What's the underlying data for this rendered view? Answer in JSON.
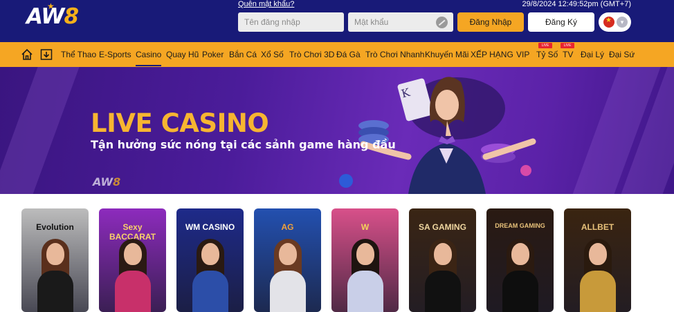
{
  "header": {
    "logo_text": "AW",
    "logo_eight": "8",
    "forgot_password": "Quên mật khẩu?",
    "datetime": "29/8/2024 12:49:52pm (GMT+7)",
    "username_placeholder": "Tên đăng nhập",
    "password_placeholder": "Mật khẩu",
    "login_label": "Đăng Nhập",
    "register_label": "Đăng Ký"
  },
  "nav": {
    "items": [
      {
        "label": "Thể Thao"
      },
      {
        "label": "E-Sports"
      },
      {
        "label": "Casino"
      },
      {
        "label": "Quay Hũ"
      },
      {
        "label": "Poker"
      },
      {
        "label": "Bắn Cá"
      },
      {
        "label": "Xổ Số"
      },
      {
        "label": "Trò Chơi 3D"
      },
      {
        "label": "Đá Gà"
      },
      {
        "label": "Trò Chơi Nhanh"
      },
      {
        "label": "Khuyến Mãi"
      },
      {
        "label": "XẾP HẠNG"
      },
      {
        "label": "VIP"
      },
      {
        "label": "Tỷ Số"
      },
      {
        "label": "TV"
      },
      {
        "label": "Đại Lý"
      },
      {
        "label": "Đại Sứ"
      }
    ],
    "active": "Casino",
    "live_badge": "LIVE"
  },
  "banner": {
    "title": "LIVE CASINO",
    "subtitle": "Tận hưởng sức nóng tại các sảnh game hàng đầu",
    "logo_text": "AW",
    "logo_eight": "8"
  },
  "providers": [
    {
      "name": "Evolution",
      "bg": "#bcbcbc"
    },
    {
      "name": "Sexy BACCARAT",
      "bg": "#8d2bbd"
    },
    {
      "name": "WM CASINO",
      "bg": "#1e2a8a"
    },
    {
      "name": "AG",
      "bg": "#2350b0"
    },
    {
      "name": "W",
      "bg": "#d8508a"
    },
    {
      "name": "SA GAMING",
      "bg": "#3a2514"
    },
    {
      "name": "DREAM GAMING",
      "bg": "#2a1a12"
    },
    {
      "name": "ALLBET",
      "bg": "#3a2410"
    }
  ]
}
